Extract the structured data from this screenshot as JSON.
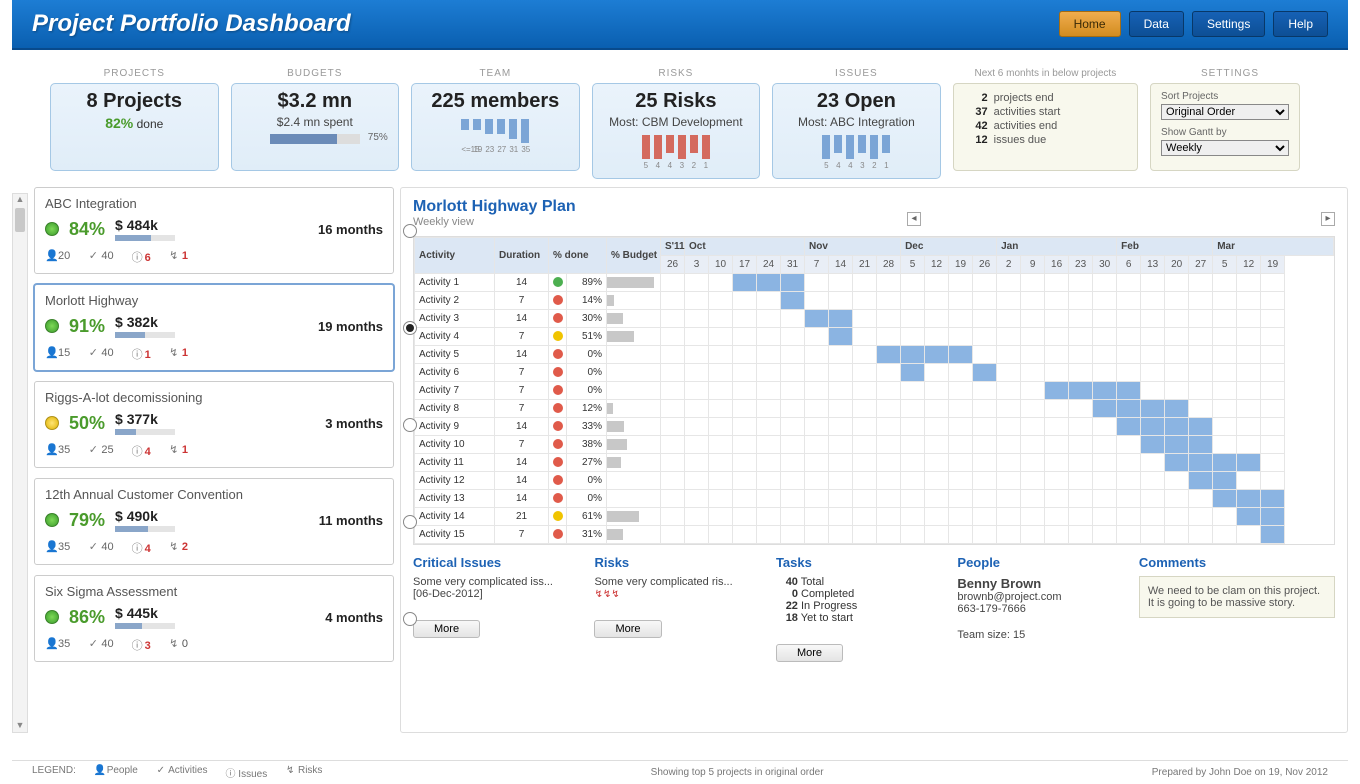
{
  "header": {
    "title": "Project Portfolio Dashboard",
    "buttons": {
      "home": "Home",
      "data": "Data",
      "settings": "Settings",
      "help": "Help"
    }
  },
  "kpi": {
    "projects": {
      "label": "PROJECTS",
      "big": "8 Projects",
      "pct": "82%",
      "done": " done"
    },
    "budgets": {
      "label": "BUDGETS",
      "big": "$3.2 mn",
      "sub": "$2.4 mn spent",
      "bar_pct": 75,
      "bar_txt": "75%"
    },
    "team": {
      "label": "TEAM",
      "big": "225 members",
      "labels": [
        "<=15",
        "19",
        "23",
        "27",
        "31",
        "35"
      ]
    },
    "risks": {
      "label": "RISKS",
      "big": "25 Risks",
      "sub": "Most: CBM Development",
      "labels": [
        "5",
        "4",
        "4",
        "3",
        "2",
        "1"
      ]
    },
    "issues": {
      "label": "ISSUES",
      "big": "23 Open",
      "sub": "Most: ABC Integration",
      "labels": [
        "5",
        "4",
        "4",
        "3",
        "2",
        "1"
      ]
    }
  },
  "forecast": {
    "head": "Next 6 monhts in below projects",
    "rows": [
      {
        "n": "2",
        "t": "projects end"
      },
      {
        "n": "37",
        "t": "activities start"
      },
      {
        "n": "42",
        "t": "activities end"
      },
      {
        "n": "12",
        "t": "issues due"
      }
    ]
  },
  "settings": {
    "label": "SETTINGS",
    "sort_lbl": "Sort Projects",
    "sort_val": "Original Order",
    "gantt_lbl": "Show Gantt by",
    "gantt_val": "Weekly"
  },
  "projects": [
    {
      "name": "ABC Integration",
      "status": "green",
      "pct": "84%",
      "budget": "$ 484k",
      "prog": 60,
      "dur": "16 months",
      "people": "20",
      "acts": "40",
      "issues": "6",
      "risks": "1"
    },
    {
      "name": "Morlott Highway",
      "status": "green",
      "pct": "91%",
      "budget": "$ 382k",
      "prog": 50,
      "dur": "19 months",
      "people": "15",
      "acts": "40",
      "issues": "1",
      "risks": "1",
      "selected": true
    },
    {
      "name": "Riggs-A-lot decomissioning",
      "status": "yellow",
      "pct": "50%",
      "budget": "$ 377k",
      "prog": 35,
      "dur": "3 months",
      "people": "35",
      "acts": "25",
      "issues": "4",
      "risks": "1"
    },
    {
      "name": "12th Annual Customer Convention",
      "status": "green",
      "pct": "79%",
      "budget": "$ 490k",
      "prog": 55,
      "dur": "11 months",
      "people": "35",
      "acts": "40",
      "issues": "4",
      "risks": "2"
    },
    {
      "name": "Six Sigma Assessment",
      "status": "green",
      "pct": "86%",
      "budget": "$ 445k",
      "prog": 45,
      "dur": "4 months",
      "people": "35",
      "acts": "40",
      "issues": "3",
      "risks": "0"
    }
  ],
  "detail": {
    "title": "Morlott Highway Plan",
    "subtitle": "Weekly view",
    "months": [
      "S'11",
      "Oct",
      "",
      "",
      "",
      "",
      "Nov",
      "",
      "",
      "",
      "Dec",
      "",
      "",
      "",
      "Jan",
      "",
      "",
      "",
      "",
      "Feb",
      "",
      "",
      "",
      "Mar",
      "",
      "",
      ""
    ],
    "days": [
      "26",
      "3",
      "10",
      "17",
      "24",
      "31",
      "7",
      "14",
      "21",
      "28",
      "5",
      "12",
      "19",
      "26",
      "2",
      "9",
      "16",
      "23",
      "30",
      "6",
      "13",
      "20",
      "27",
      "5",
      "12",
      "19"
    ],
    "cols": {
      "activity": "Activity",
      "duration": "Duration",
      "pct": "% done",
      "budget": "% Budget"
    },
    "activities": [
      {
        "n": "Activity 1",
        "dur": 14,
        "st": "green",
        "pct": "89%",
        "b": 89,
        "bars": [
          3,
          4,
          5
        ]
      },
      {
        "n": "Activity 2",
        "dur": 7,
        "st": "red",
        "pct": "14%",
        "b": 14,
        "bars": [
          5
        ]
      },
      {
        "n": "Activity 3",
        "dur": 14,
        "st": "red",
        "pct": "30%",
        "b": 30,
        "bars": [
          6,
          7
        ]
      },
      {
        "n": "Activity 4",
        "dur": 7,
        "st": "yellow",
        "pct": "51%",
        "b": 51,
        "bars": [
          7
        ]
      },
      {
        "n": "Activity 5",
        "dur": 14,
        "st": "red",
        "pct": "0%",
        "b": 0,
        "bars": [
          9,
          10,
          11,
          12
        ]
      },
      {
        "n": "Activity 6",
        "dur": 7,
        "st": "red",
        "pct": "0%",
        "b": 0,
        "bars": [
          10,
          13
        ]
      },
      {
        "n": "Activity 7",
        "dur": 7,
        "st": "red",
        "pct": "0%",
        "b": 0,
        "bars": [
          16,
          17,
          18,
          19
        ]
      },
      {
        "n": "Activity 8",
        "dur": 7,
        "st": "red",
        "pct": "12%",
        "b": 12,
        "bars": [
          18,
          19,
          20,
          21
        ]
      },
      {
        "n": "Activity 9",
        "dur": 14,
        "st": "red",
        "pct": "33%",
        "b": 33,
        "bars": [
          19,
          20,
          21,
          22
        ]
      },
      {
        "n": "Activity 10",
        "dur": 7,
        "st": "red",
        "pct": "38%",
        "b": 38,
        "bars": [
          20,
          21,
          22
        ]
      },
      {
        "n": "Activity 11",
        "dur": 14,
        "st": "red",
        "pct": "27%",
        "b": 27,
        "bars": [
          21,
          22,
          23,
          24
        ]
      },
      {
        "n": "Activity 12",
        "dur": 14,
        "st": "red",
        "pct": "0%",
        "b": 0,
        "bars": [
          22,
          23
        ]
      },
      {
        "n": "Activity 13",
        "dur": 14,
        "st": "red",
        "pct": "0%",
        "b": 0,
        "bars": [
          23,
          24,
          25
        ]
      },
      {
        "n": "Activity 14",
        "dur": 21,
        "st": "yellow",
        "pct": "61%",
        "b": 61,
        "bars": [
          24,
          25
        ]
      },
      {
        "n": "Activity 15",
        "dur": 7,
        "st": "red",
        "pct": "31%",
        "b": 31,
        "bars": [
          25
        ]
      }
    ]
  },
  "critical": {
    "head": "Critical Issues",
    "txt": "Some very complicated iss...",
    "date": "[06-Dec-2012]",
    "more": "More"
  },
  "risks_panel": {
    "head": "Risks",
    "txt": "Some very complicated ris...",
    "more": "More"
  },
  "tasks": {
    "head": "Tasks",
    "total_n": "40",
    "total": "Total",
    "comp_n": "0",
    "comp": "Completed",
    "prog_n": "22",
    "prog": "In Progress",
    "yet_n": "18",
    "yet": "Yet to start",
    "more": "More"
  },
  "people": {
    "head": "People",
    "name": "Benny Brown",
    "email": "brownb@project.com",
    "phone": "663-179-7666",
    "team": "Team size: 15"
  },
  "comments": {
    "head": "Comments",
    "txt": "We need to be clam on this project. It is going to be massive story."
  },
  "footer": {
    "legend_lbl": "LEGEND:",
    "people": "People",
    "acts": "Activities",
    "issues": "Issues",
    "risks": "Risks",
    "center": "Showing top 5 projects in original order",
    "right": "Prepared by John Doe on 19, Nov 2012"
  },
  "chart_data": {
    "team_hist": {
      "type": "bar",
      "categories": [
        "<=15",
        "19",
        "23",
        "27",
        "31",
        "35"
      ],
      "values": [
        1,
        1,
        2,
        2,
        3,
        4
      ]
    },
    "risks_hist": {
      "type": "bar",
      "categories": [
        "5",
        "4",
        "4",
        "3",
        "2",
        "1"
      ],
      "values": [
        3,
        3,
        2,
        3,
        2,
        3
      ]
    },
    "issues_hist": {
      "type": "bar",
      "categories": [
        "5",
        "4",
        "4",
        "3",
        "2",
        "1"
      ],
      "values": [
        3,
        2,
        3,
        2,
        3,
        2
      ]
    }
  }
}
